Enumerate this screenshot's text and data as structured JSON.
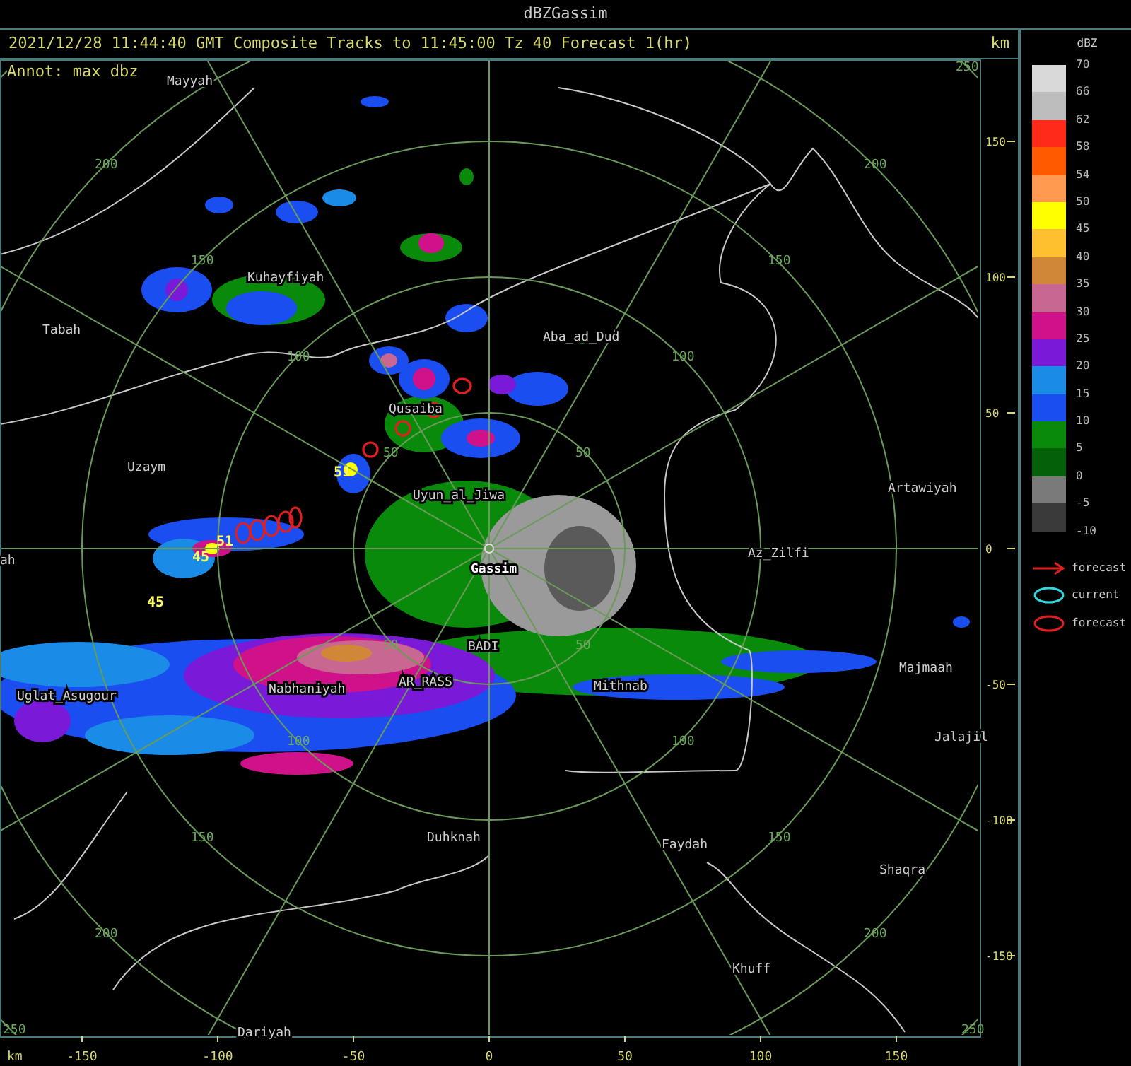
{
  "window": {
    "title": "dBZGassim"
  },
  "header": {
    "text": "2021/12/28 11:44:40 GMT Composite Tracks to 11:45:00 Tz 40 Forecast 1(hr)",
    "unit": "km"
  },
  "map": {
    "annotation": "Annot: max dbz",
    "places": [
      {
        "label": "Mayyah"
      },
      {
        "label": "Kuhayfiyah"
      },
      {
        "label": "Tabah"
      },
      {
        "label": "Aba_ad_Dud"
      },
      {
        "label": "Qusaiba"
      },
      {
        "label": "Uzaym"
      },
      {
        "label": "Uyun_al_Jiwa"
      },
      {
        "label": "Artawiyah"
      },
      {
        "label": "ah"
      },
      {
        "label": "Az_Zilfi"
      },
      {
        "label": "Gassim"
      },
      {
        "label": "BADI"
      },
      {
        "label": "AR_RASS"
      },
      {
        "label": "Nabhaniyah"
      },
      {
        "label": "Uglat_Asugour"
      },
      {
        "label": "Mithnab"
      },
      {
        "label": "Majmaah"
      },
      {
        "label": "Jalajil"
      },
      {
        "label": "Duhknah"
      },
      {
        "label": "Faydah"
      },
      {
        "label": "Shaqra"
      },
      {
        "label": "Khuff"
      },
      {
        "label": "Dariyah"
      }
    ],
    "range_labels": [
      "250",
      "200",
      "200",
      "150",
      "150",
      "100",
      "100",
      "50",
      "50",
      "50",
      "50",
      "100",
      "100",
      "150",
      "150",
      "200",
      "200",
      "250",
      "250"
    ],
    "track_labels": [
      "51",
      "51",
      "45",
      "45"
    ],
    "x_axis": {
      "unit": "km",
      "ticks": [
        "-150",
        "-100",
        "-50",
        "0",
        "50",
        "100",
        "150"
      ]
    },
    "y_axis": {
      "ticks": [
        "150",
        "100",
        "50",
        "0",
        "-50",
        "-100",
        "-150"
      ]
    }
  },
  "legend": {
    "title": "dBZ",
    "swatches": [
      {
        "color": "#d9d9d9"
      },
      {
        "color": "#bdbdbd"
      },
      {
        "color": "#ff2a1a"
      },
      {
        "color": "#ff5a00"
      },
      {
        "color": "#ff9a50"
      },
      {
        "color": "#ffff00"
      },
      {
        "color": "#ffc030"
      },
      {
        "color": "#d08838"
      },
      {
        "color": "#c86890"
      },
      {
        "color": "#d0128a"
      },
      {
        "color": "#7a1ad8"
      },
      {
        "color": "#1a8ce8"
      },
      {
        "color": "#1a4ef0"
      },
      {
        "color": "#0a8a0a"
      },
      {
        "color": "#05600a"
      },
      {
        "color": "#7a7a7a"
      },
      {
        "color": "#3a3a3a"
      }
    ],
    "labels": [
      "70",
      "66",
      "62",
      "58",
      "54",
      "50",
      "45",
      "40",
      "35",
      "30",
      "25",
      "20",
      "15",
      "10",
      "5",
      "0",
      "-5",
      "-10"
    ],
    "symbols": [
      {
        "kind": "arrow",
        "color": "#e02020",
        "label": "forecast"
      },
      {
        "kind": "ellipse",
        "color": "#30d8e0",
        "label": "current"
      },
      {
        "kind": "ellipse",
        "color": "#e02020",
        "label": "forecast"
      }
    ]
  }
}
